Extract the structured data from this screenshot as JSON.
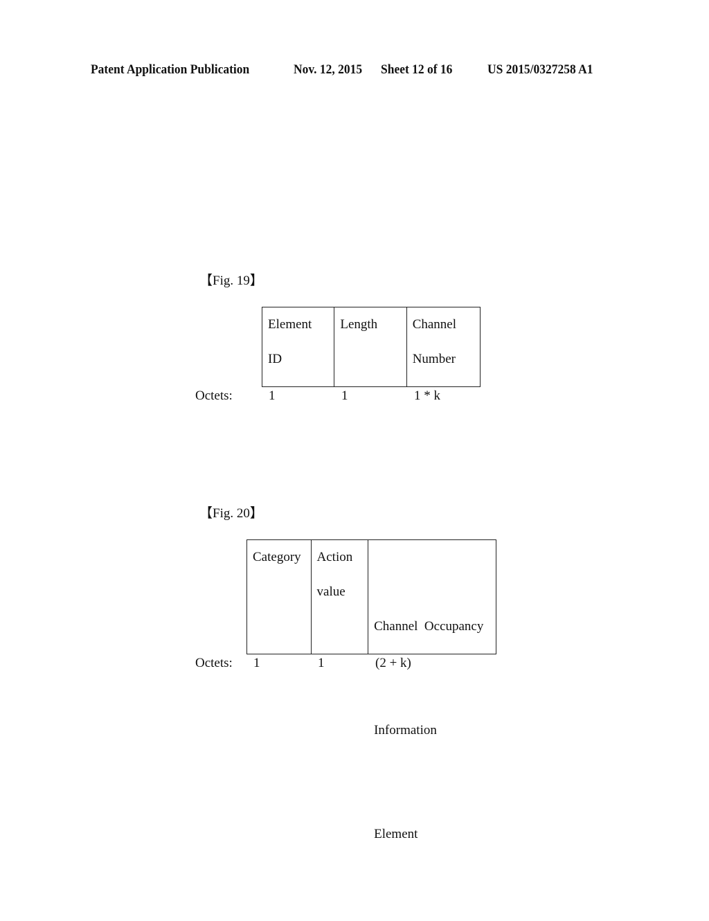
{
  "header": {
    "publication": "Patent Application Publication",
    "date": "Nov. 12, 2015",
    "sheet": "Sheet 12 of 16",
    "number": "US 2015/0327258 A1"
  },
  "figures": [
    {
      "label": "【Fig. 19】",
      "columns": [
        {
          "lines": [
            "Element",
            "ID"
          ],
          "octets": "1"
        },
        {
          "lines": [
            "Length"
          ],
          "octets": "1"
        },
        {
          "lines": [
            "Channel",
            "Number"
          ],
          "octets": "1 * k"
        }
      ],
      "octets_label": "Octets:"
    },
    {
      "label": "【Fig. 20】",
      "columns": [
        {
          "lines": [
            "Category"
          ],
          "octets": "1"
        },
        {
          "lines": [
            "Action",
            "value"
          ],
          "octets": "1"
        },
        {
          "lines": [
            "Channel  Occupancy",
            "Information",
            "Element"
          ],
          "octets": "(2 + k)"
        }
      ],
      "octets_label": "Octets:"
    }
  ]
}
